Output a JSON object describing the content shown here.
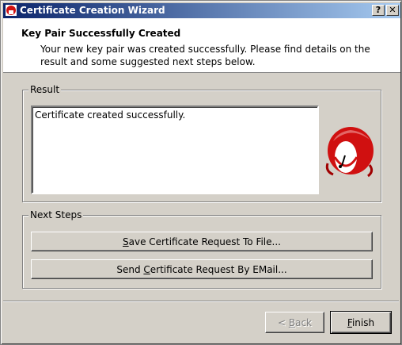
{
  "window": {
    "title": "Certificate Creation Wizard",
    "help_glyph": "?",
    "close_glyph": "✕"
  },
  "header": {
    "title": "Key Pair Successfully Created",
    "description": "Your new key pair was created successfully. Please find details on the result and some suggested next steps below."
  },
  "result": {
    "group_label": "Result",
    "text": "Certificate created successfully.",
    "icon": "mascot-icon"
  },
  "next_steps": {
    "group_label": "Next Steps",
    "save_button": {
      "prefix": "",
      "mnemonic": "S",
      "suffix": "ave Certificate Request To File..."
    },
    "send_button": {
      "prefix": "Send ",
      "mnemonic": "C",
      "suffix": "ertificate Request By EMail..."
    }
  },
  "footer": {
    "back_button": {
      "prefix": "< ",
      "mnemonic": "B",
      "suffix": "ack",
      "enabled": false
    },
    "finish_button": {
      "prefix": "",
      "mnemonic": "F",
      "suffix": "inish"
    }
  },
  "colors": {
    "titlebar_start": "#0a246a",
    "titlebar_end": "#a6caf0",
    "face": "#d4d0c8",
    "mascot_red": "#d01010"
  }
}
